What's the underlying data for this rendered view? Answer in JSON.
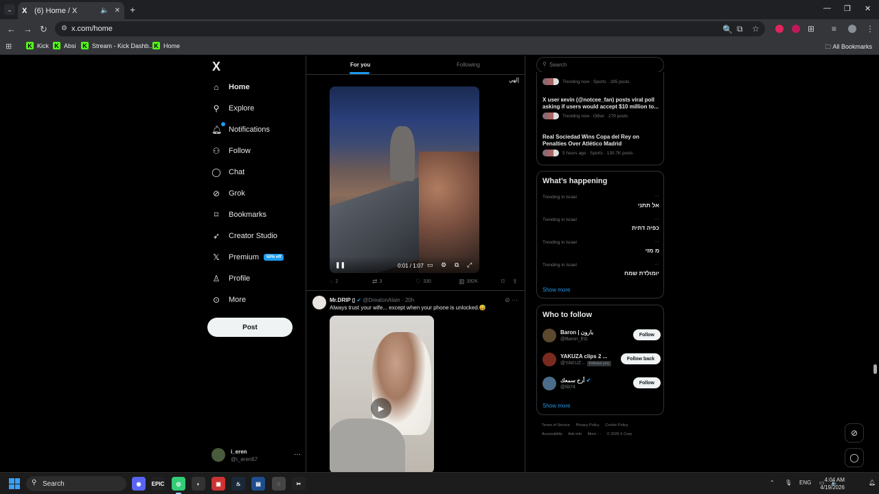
{
  "browser": {
    "tab_title": "(6) Home / X",
    "tab_favicon": "X",
    "url": "x.com/home",
    "bookmarks": [
      {
        "label": "Kick"
      },
      {
        "label": "Absi"
      },
      {
        "label": "Stream - Kick Dashb..."
      },
      {
        "label": "Home"
      }
    ],
    "all_bookmarks": "All Bookmarks"
  },
  "nav": {
    "logo": "X",
    "items": [
      {
        "label": "Home",
        "icon": "home-icon"
      },
      {
        "label": "Explore",
        "icon": "search-icon"
      },
      {
        "label": "Notifications",
        "icon": "bell-icon"
      },
      {
        "label": "Follow",
        "icon": "add-person-icon"
      },
      {
        "label": "Chat",
        "icon": "chat-icon"
      },
      {
        "label": "Grok",
        "icon": "grok-icon"
      },
      {
        "label": "Bookmarks",
        "icon": "bookmark-icon"
      },
      {
        "label": "Creator Studio",
        "icon": "rocket-icon"
      },
      {
        "label": "Premium",
        "icon": "x-icon"
      },
      {
        "label": "Profile",
        "icon": "person-icon"
      },
      {
        "label": "More",
        "icon": "more-circle-icon"
      }
    ],
    "premium_badge": "50% off",
    "post_button": "Post",
    "user": {
      "name": "i_eren",
      "handle": "@i_eren67"
    }
  },
  "feed": {
    "tabs": [
      "For you",
      "Following"
    ],
    "active_tab": "For you",
    "tweet1": {
      "text_snippet": "إلهي",
      "video_time": "0:01 / 1:07",
      "replies": "2",
      "reposts": "3",
      "likes": "330",
      "views": "392K"
    },
    "tweet2": {
      "name": "Mr.DRIP ▯",
      "handle": "@DreatonAlain",
      "time": "· 20h",
      "text": "Always trust your wife... except when your phone is unlocked.😅"
    }
  },
  "sidebar": {
    "search_placeholder": "Search",
    "news": [
      {
        "title": "",
        "meta": "Trending now · Sports · 285 posts"
      },
      {
        "title": "X user кevin (@notcee_fan) posts viral poll asking if users would accept $10 million to...",
        "meta": "Trending now · Other · 279 posts"
      },
      {
        "title": "Real Sociedad Wins Copa del Rey on Penalties Over Atlético Madrid",
        "meta": "5 hours ago · Sports · 130.7K posts"
      }
    ],
    "whats_happening": {
      "title": "What’s happening",
      "trends": [
        {
          "context": "Trending in Israel",
          "name": "אל תתני"
        },
        {
          "context": "Trending in Israel",
          "name": "כפיה דתית"
        },
        {
          "context": "Trending in Israel",
          "name": "מ מזי"
        },
        {
          "context": "Trending in Israel",
          "name": "יומולדת שמח"
        }
      ],
      "show_more": "Show more"
    },
    "who_to_follow": {
      "title": "Who to follow",
      "users": [
        {
          "name": "Baron | بارون",
          "handle": "@Baron_EG",
          "follows_you": "",
          "button": "Follow"
        },
        {
          "name": "YAKUZA clips 2 ...",
          "handle": "@YAKUZ...",
          "follows_you": "Follows you",
          "button": "Follow back"
        },
        {
          "name": "أرح سمعك",
          "handle": "@lib74",
          "follows_you": "",
          "button": "Follow"
        }
      ],
      "show_more": "Show more"
    },
    "footer": [
      "Terms of Service",
      "Privacy Policy",
      "Cookie Policy",
      "Accessibility",
      "Ads info",
      "More ···",
      "© 2026 X Corp."
    ]
  },
  "taskbar": {
    "search": "Search",
    "lang": "ENG",
    "time": "4:04 AM",
    "date": "4/19/2026"
  },
  "colors": {
    "accent": "#1d9bf0",
    "background": "#000000"
  }
}
